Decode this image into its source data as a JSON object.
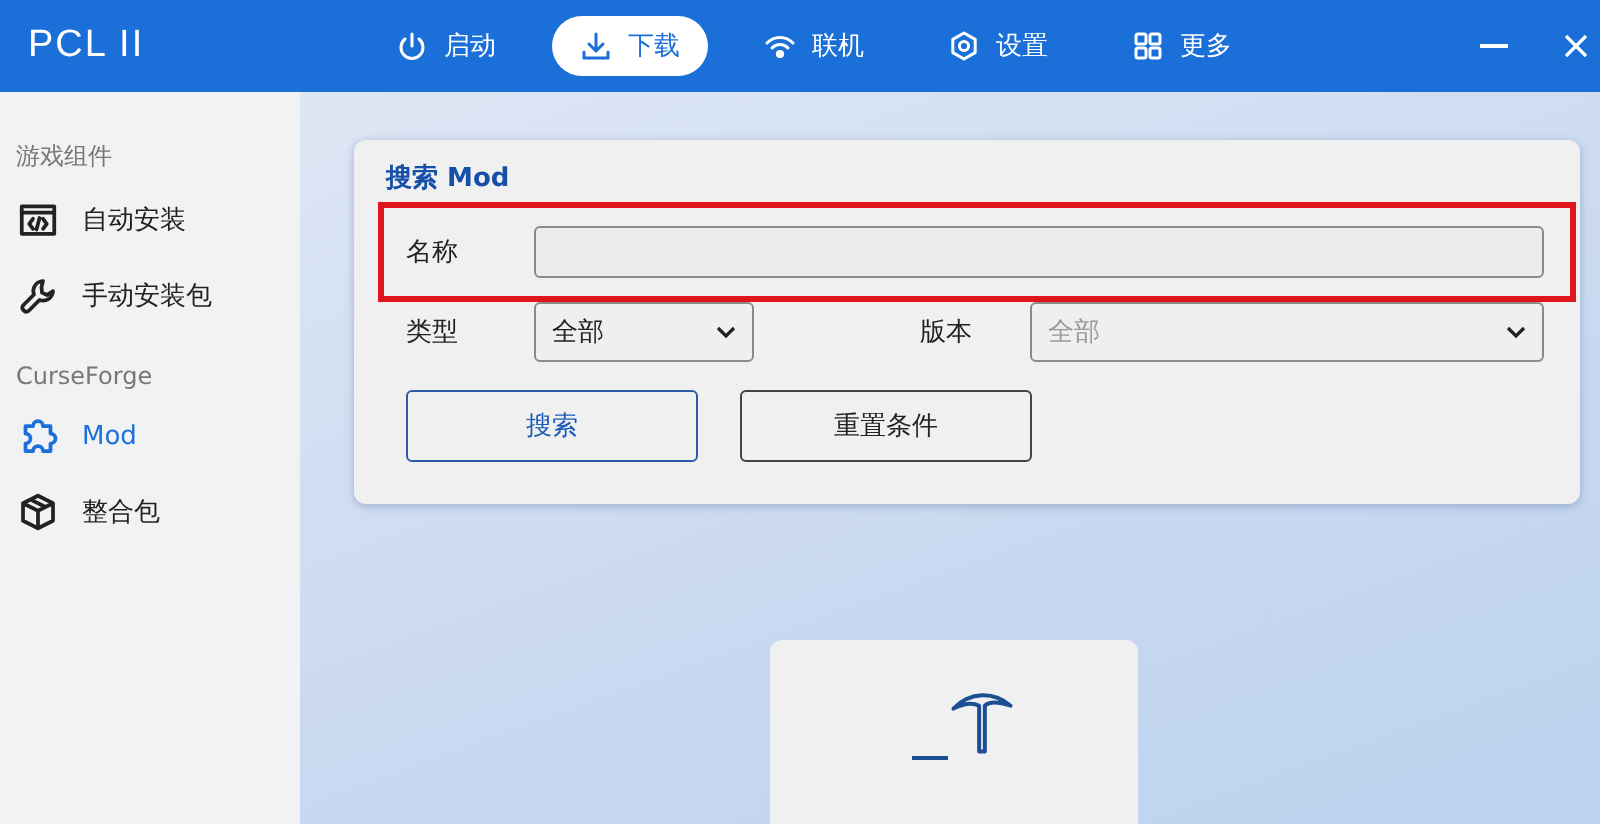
{
  "window": {
    "title": "PCL II"
  },
  "nav": [
    {
      "label": "启动",
      "selected": false
    },
    {
      "label": "下载",
      "selected": true
    },
    {
      "label": "联机",
      "selected": false
    },
    {
      "label": "设置",
      "selected": false
    },
    {
      "label": "更多",
      "selected": false
    }
  ],
  "sidebar": {
    "groups": [
      {
        "heading": "游戏组件",
        "items": [
          {
            "label": "自动安装",
            "selected": false
          },
          {
            "label": "手动安装包",
            "selected": false
          }
        ]
      },
      {
        "heading": "CurseForge",
        "items": [
          {
            "label": "Mod",
            "selected": true
          },
          {
            "label": "整合包",
            "selected": false
          }
        ]
      }
    ]
  },
  "search_card": {
    "title": "搜索 Mod",
    "name_field": {
      "label": "名称",
      "highlighted": true
    },
    "type_select": {
      "label": "类型",
      "value": "全部",
      "disabled": false
    },
    "version_select": {
      "label": "版本",
      "value": "全部",
      "disabled": true
    },
    "buttons": [
      {
        "label": "搜索",
        "kind": "primary"
      },
      {
        "label": "重置条件",
        "kind": "secondary"
      }
    ]
  }
}
